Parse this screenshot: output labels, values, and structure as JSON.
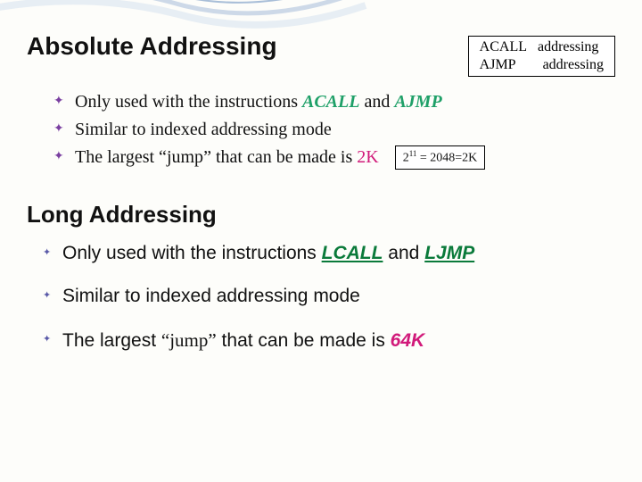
{
  "heading1": "Absolute Addressing",
  "box": {
    "r1a": "ACALL",
    "r1b": "addressing",
    "r2a": "AJMP",
    "r2b": "addressing"
  },
  "bullets1": {
    "b1_pre": "Only used with the instructions ",
    "b1_kw1": "ACALL",
    "b1_mid": " and ",
    "b1_kw2": "AJMP",
    "b2": "Similar to indexed addressing mode",
    "b3_pre": "The largest ",
    "b3_q1": "“",
    "b3_word": "jump",
    "b3_q2": "”",
    "b3_post": " that can be made is ",
    "b3_kw": "2K"
  },
  "smallbox": {
    "pre": "2",
    "sup": "11",
    "post": " = 2048=2K"
  },
  "heading2": "Long Addressing",
  "bullets2": {
    "b1_pre": "Only used with the instructions ",
    "b1_kw1": "LCALL",
    "b1_mid": " and ",
    "b1_kw2": "LJMP",
    "b2": "Similar to indexed addressing mode",
    "b3_pre": "The largest ",
    "b3_q1": "“",
    "b3_word": "jump",
    "b3_q2": "”",
    "b3_post": " that can be made is ",
    "b3_kw": "64K"
  }
}
